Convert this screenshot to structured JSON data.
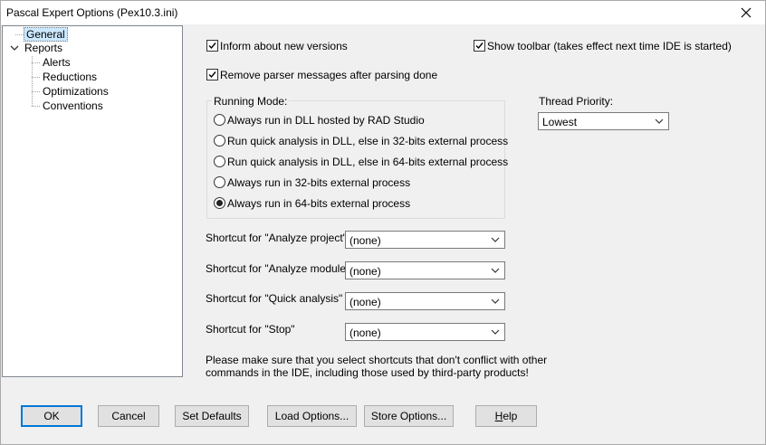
{
  "window": {
    "title": "Pascal Expert Options (Pex10.3.ini)"
  },
  "tree": {
    "items": [
      {
        "label": "General"
      },
      {
        "label": "Reports"
      },
      {
        "label": "Alerts"
      },
      {
        "label": "Reductions"
      },
      {
        "label": "Optimizations"
      },
      {
        "label": "Conventions"
      }
    ]
  },
  "options": {
    "inform": {
      "label": "Inform about new versions",
      "checked": true
    },
    "toolbar": {
      "label": "Show toolbar (takes effect next time IDE is started)",
      "checked": true
    },
    "remove": {
      "label": "Remove parser messages after parsing done",
      "checked": true
    }
  },
  "running_mode": {
    "legend": "Running Mode:",
    "options": [
      {
        "label": "Always run in DLL hosted by RAD Studio",
        "selected": false
      },
      {
        "label": "Run quick analysis in DLL, else in 32-bits external process",
        "selected": false
      },
      {
        "label": "Run quick analysis in DLL, else in 64-bits external process",
        "selected": false
      },
      {
        "label": "Always run in 32-bits external process",
        "selected": false
      },
      {
        "label": "Always run in 64-bits external process",
        "selected": true
      }
    ]
  },
  "thread_priority": {
    "label": "Thread Priority:",
    "value": "Lowest"
  },
  "shortcuts": [
    {
      "label": "Shortcut for \"Analyze project\"",
      "value": "(none)"
    },
    {
      "label": "Shortcut for \"Analyze module\"",
      "value": "(none)"
    },
    {
      "label": "Shortcut for \"Quick analysis\"",
      "value": "(none)"
    },
    {
      "label": "Shortcut for \"Stop\"",
      "value": "(none)"
    }
  ],
  "note": {
    "line1": "Please make sure that you select shortcuts that don't conflict with other",
    "line2": "commands in the IDE, including those used by third-party products!"
  },
  "buttons": {
    "ok": "OK",
    "cancel": "Cancel",
    "set_defaults": "Set Defaults",
    "load_options": "Load Options...",
    "store_options": "Store Options...",
    "help_h": "H",
    "help_rest": "elp"
  }
}
